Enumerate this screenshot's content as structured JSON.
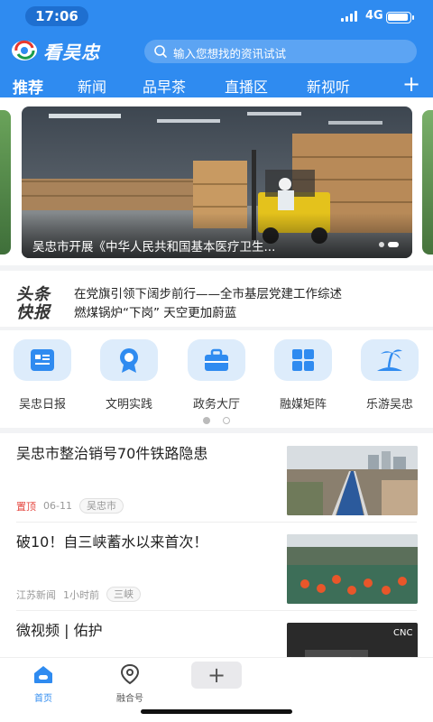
{
  "status_bar": {
    "time": "17:06",
    "network": "4G"
  },
  "header": {
    "app_name": "看吴忠",
    "search_placeholder": "输入您想找的资讯试试"
  },
  "tabs": [
    "推荐",
    "新闻",
    "品早茶",
    "直播区",
    "新视听"
  ],
  "banner": {
    "caption": "吴忠市开展《中华人民共和国基本医疗卫生..."
  },
  "flash": {
    "logo_line1": "头条",
    "logo_line2": "快报",
    "items": [
      "在党旗引领下阔步前行——全市基层党建工作综述",
      "燃煤锅炉“下岗” 天空更加蔚蓝"
    ]
  },
  "services": [
    {
      "label": "吴忠日报",
      "icon": "newspaper-icon"
    },
    {
      "label": "文明实践",
      "icon": "medal-icon"
    },
    {
      "label": "政务大厅",
      "icon": "briefcase-icon"
    },
    {
      "label": "融媒矩阵",
      "icon": "grid-icon"
    },
    {
      "label": "乐游吴忠",
      "icon": "palm-island-icon"
    }
  ],
  "news": [
    {
      "title": "吴忠市整治销号70件铁路隐患",
      "tag": "置顶",
      "date": "06-11",
      "location": "吴忠市"
    },
    {
      "title": "破10！自三峡蓄水以来首次！",
      "source": "江苏新闻",
      "time": "1小时前",
      "location": "三峡"
    },
    {
      "title": "微视频 | 佑护",
      "thumb_text": "CNC"
    }
  ],
  "bottom_nav": {
    "home": "首页",
    "fusion": "融合号",
    "add": "+"
  },
  "colors": {
    "primary": "#2f8bf0",
    "pin_red": "#e5463f"
  }
}
